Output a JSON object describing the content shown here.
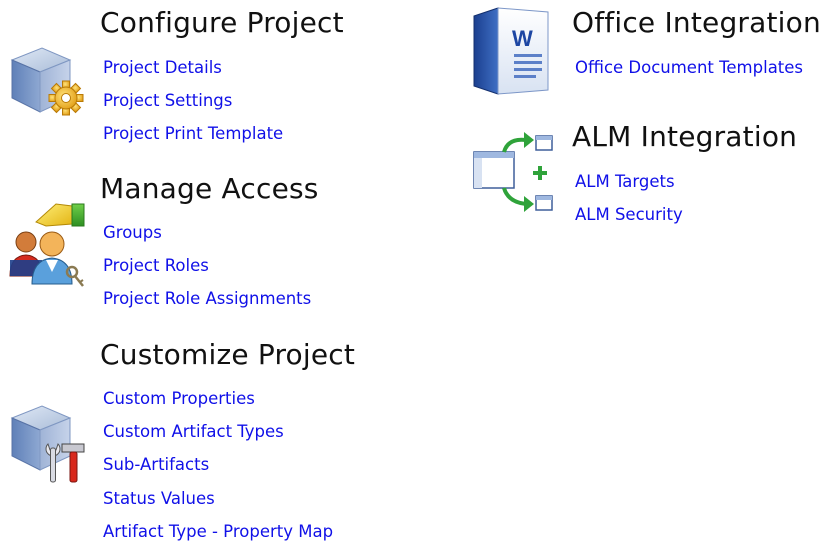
{
  "configure_project": {
    "title": "Configure Project",
    "icon": "cube-gear-icon",
    "links": [
      "Project Details",
      "Project Settings",
      "Project Print Template"
    ]
  },
  "manage_access": {
    "title": "Manage Access",
    "icon": "users-key-icon",
    "links": [
      "Groups",
      "Project Roles",
      "Project Role Assignments"
    ]
  },
  "customize_project": {
    "title": "Customize Project",
    "icon": "cube-tools-icon",
    "links": [
      "Custom Properties",
      "Custom Artifact Types",
      "Sub-Artifacts",
      "Status Values",
      "Artifact Type - Property Map"
    ]
  },
  "office_integration": {
    "title": "Office Integration",
    "icon": "word-document-icon",
    "links": [
      "Office Document Templates"
    ]
  },
  "alm_integration": {
    "title": "ALM Integration",
    "icon": "sync-windows-icon",
    "links": [
      "ALM Targets",
      "ALM Security"
    ]
  },
  "colors": {
    "link": "#1010e8",
    "heading": "#111111",
    "background": "#ffffff"
  }
}
